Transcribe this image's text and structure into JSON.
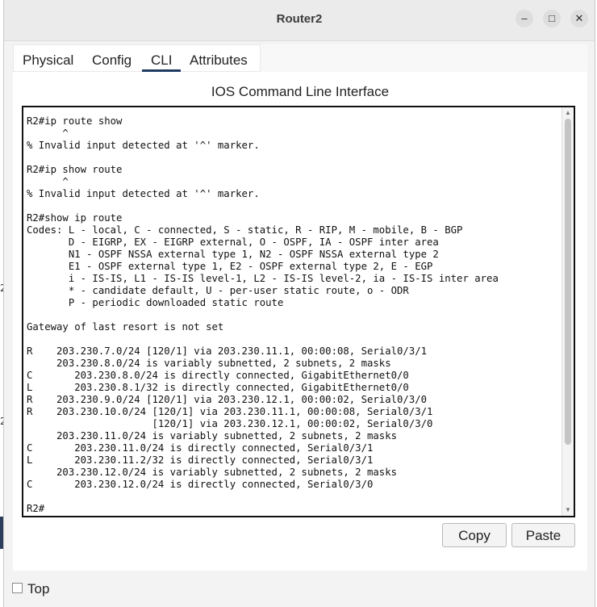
{
  "window": {
    "title": "Router2",
    "minimize_glyph": "–",
    "maximize_glyph": "□",
    "close_glyph": "✕"
  },
  "tabs": [
    {
      "label": "Physical",
      "active": false
    },
    {
      "label": "Config",
      "active": false
    },
    {
      "label": "CLI",
      "active": true
    },
    {
      "label": "Attributes",
      "active": false
    }
  ],
  "cli": {
    "title": "IOS Command Line Interface",
    "output": "R2#ip route show\n      ^\n% Invalid input detected at '^' marker.\n\nR2#ip show route\n      ^\n% Invalid input detected at '^' marker.\n\nR2#show ip route\nCodes: L - local, C - connected, S - static, R - RIP, M - mobile, B - BGP\n       D - EIGRP, EX - EIGRP external, O - OSPF, IA - OSPF inter area\n       N1 - OSPF NSSA external type 1, N2 - OSPF NSSA external type 2\n       E1 - OSPF external type 1, E2 - OSPF external type 2, E - EGP\n       i - IS-IS, L1 - IS-IS level-1, L2 - IS-IS level-2, ia - IS-IS inter area\n       * - candidate default, U - per-user static route, o - ODR\n       P - periodic downloaded static route\n\nGateway of last resort is not set\n\nR    203.230.7.0/24 [120/1] via 203.230.11.1, 00:00:08, Serial0/3/1\n     203.230.8.0/24 is variably subnetted, 2 subnets, 2 masks\nC       203.230.8.0/24 is directly connected, GigabitEthernet0/0\nL       203.230.8.1/32 is directly connected, GigabitEthernet0/0\nR    203.230.9.0/24 [120/1] via 203.230.12.1, 00:00:02, Serial0/3/0\nR    203.230.10.0/24 [120/1] via 203.230.11.1, 00:00:08, Serial0/3/1\n                     [120/1] via 203.230.12.1, 00:00:02, Serial0/3/0\n     203.230.11.0/24 is variably subnetted, 2 subnets, 2 masks\nC       203.230.11.0/24 is directly connected, Serial0/3/1\nL       203.230.11.2/32 is directly connected, Serial0/3/1\n     203.230.12.0/24 is variably subnetted, 2 subnets, 2 masks\nC       203.230.12.0/24 is directly connected, Serial0/3/0\n\nR2#",
    "scroll_up_glyph": "▲",
    "scroll_down_glyph": "▼"
  },
  "buttons": {
    "copy": "Copy",
    "paste": "Paste"
  },
  "footer": {
    "top_label": "Top",
    "top_checked": false
  },
  "edge": {
    "glyph_a": "2",
    "glyph_b": "2"
  },
  "colors": {
    "tab_active_underline": "#1f3a5f",
    "edge_bar": "#2c3e5c"
  }
}
